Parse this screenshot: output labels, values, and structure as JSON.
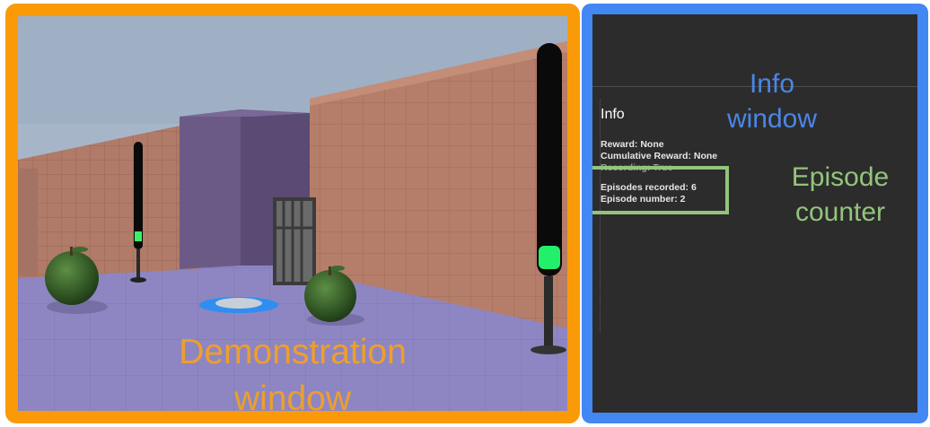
{
  "demonstration": {
    "label_line1": "Demonstration",
    "label_line2": "window",
    "border_color": "#fb9a09",
    "label_color": "#f7a21f"
  },
  "info_panel": {
    "title": "Info",
    "lines": {
      "reward": "Reward: None",
      "cumulative_reward": "Cumulative Reward: None",
      "partially_hidden": "Recording: True",
      "episodes_recorded": "Episodes recorded: 6",
      "episode_number": "Episode number: 2"
    },
    "border_color": "#4387f3",
    "background": "#2c2c2c"
  },
  "annotations": {
    "info_window_line1": "Info",
    "info_window_line2": "window",
    "episode_counter_line1": "Episode",
    "episode_counter_line2": "counter",
    "info_color": "#4a86e8",
    "counter_color": "#93c47d"
  },
  "scene": {
    "items": [
      "left-tower",
      "right-tower",
      "left-apple",
      "right-apple",
      "goal-pad",
      "gate"
    ]
  }
}
